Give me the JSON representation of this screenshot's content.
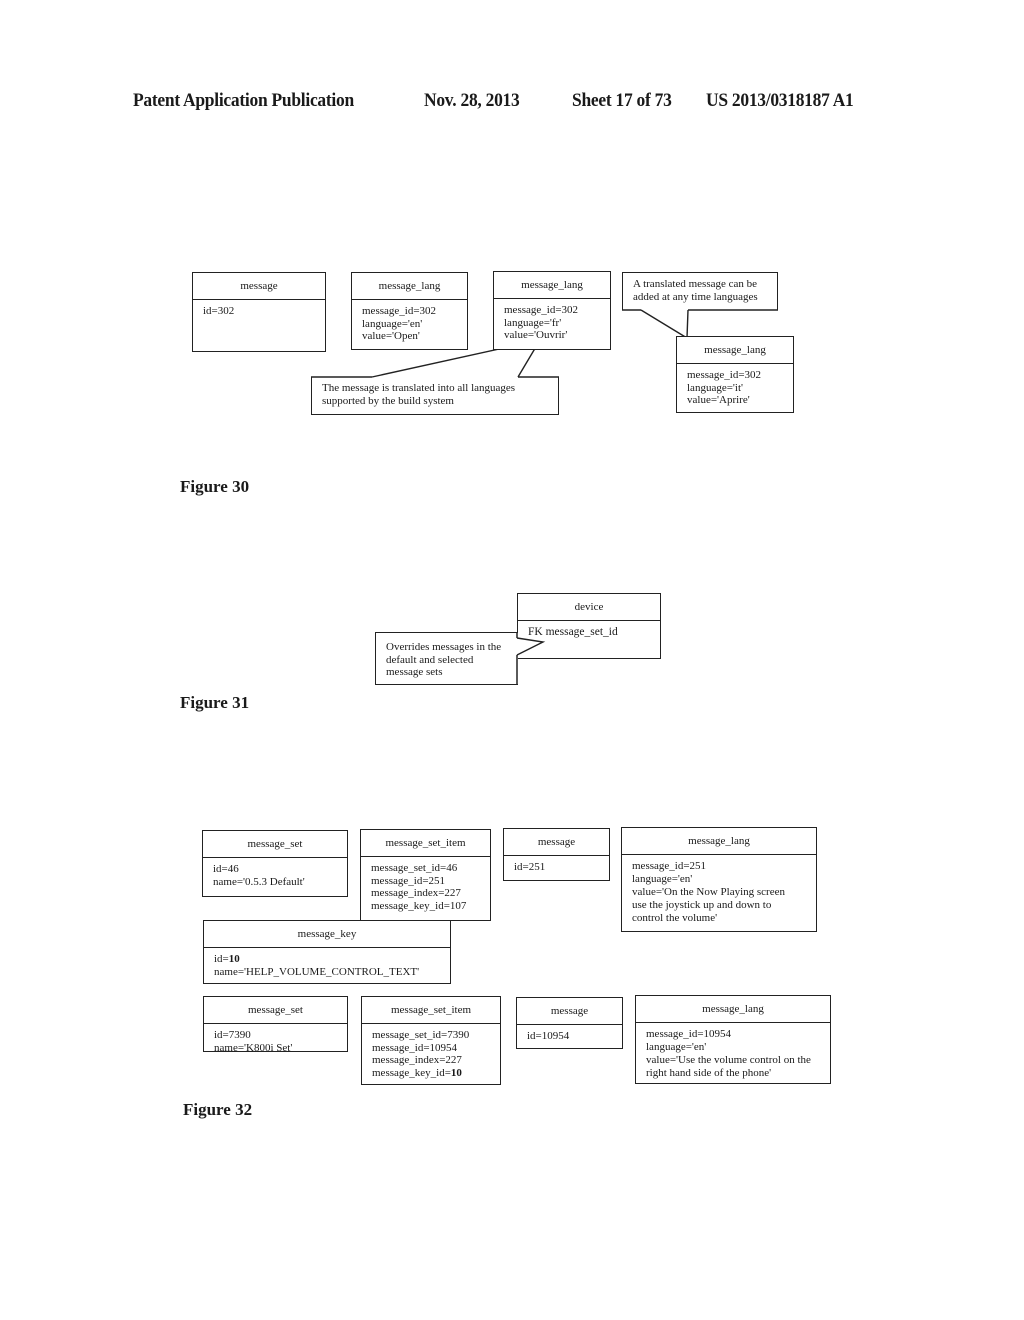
{
  "header": {
    "publication": "Patent Application Publication",
    "date": "Nov. 28, 2013",
    "sheet": "Sheet 17 of 73",
    "number": "US 2013/0318187 A1"
  },
  "figure30": {
    "label": "Figure 30",
    "message": {
      "title": "message",
      "fields": [
        "id=302"
      ]
    },
    "lang_en": {
      "title": "message_lang",
      "fields": [
        "message_id=302",
        "language='en'",
        "value='Open'"
      ]
    },
    "lang_fr": {
      "title": "message_lang",
      "fields": [
        "message_id=302",
        "language='fr'",
        "value='Ouvrir'"
      ]
    },
    "lang_it": {
      "title": "message_lang",
      "fields": [
        "message_id=302",
        "language='it'",
        "value='Aprire'"
      ]
    },
    "note_translated": [
      "The message is translated into all languages",
      "supported by the build system"
    ],
    "note_added": [
      "A translated message can be",
      "added at any time languages"
    ]
  },
  "figure31": {
    "label": "Figure 31",
    "device": {
      "title": "device",
      "fields": [
        "FK message_set_id"
      ]
    },
    "note_overrides": [
      "Overrides messages in the",
      "default and selected",
      "message sets"
    ]
  },
  "figure32": {
    "label": "Figure 32",
    "row1": {
      "message_set": {
        "title": "message_set",
        "fields": [
          "id=46",
          "name='0.5.3 Default'"
        ]
      },
      "message_set_item": {
        "title": "message_set_item",
        "fields": [
          "message_set_id=46",
          "message_id=251",
          "message_index=227",
          "message_key_id=107"
        ]
      },
      "message": {
        "title": "message",
        "fields": [
          "id=251"
        ]
      },
      "message_lang": {
        "title": "message_lang",
        "fields": [
          "message_id=251",
          "language='en'",
          "value='On the Now Playing screen",
          "use the joystick up and down to",
          "control the volume'"
        ]
      }
    },
    "message_key": {
      "title": "message_key",
      "id_prefix": "id=",
      "id_value": "10",
      "name": "name='HELP_VOLUME_CONTROL_TEXT'"
    },
    "row2": {
      "message_set": {
        "title": "message_set",
        "fields": [
          "id=7390",
          "name='K800i Set'"
        ]
      },
      "message_set_item": {
        "title": "message_set_item",
        "fields": [
          "message_set_id=7390",
          "message_id=10954",
          "message_index=227"
        ],
        "key_prefix": "message_key_id=",
        "key_value": "10"
      },
      "message": {
        "title": "message",
        "fields": [
          "id=10954"
        ]
      },
      "message_lang": {
        "title": "message_lang",
        "fields": [
          "message_id=10954",
          "language='en'",
          "value='Use the volume control on the",
          "right hand side of the phone'"
        ]
      }
    }
  }
}
